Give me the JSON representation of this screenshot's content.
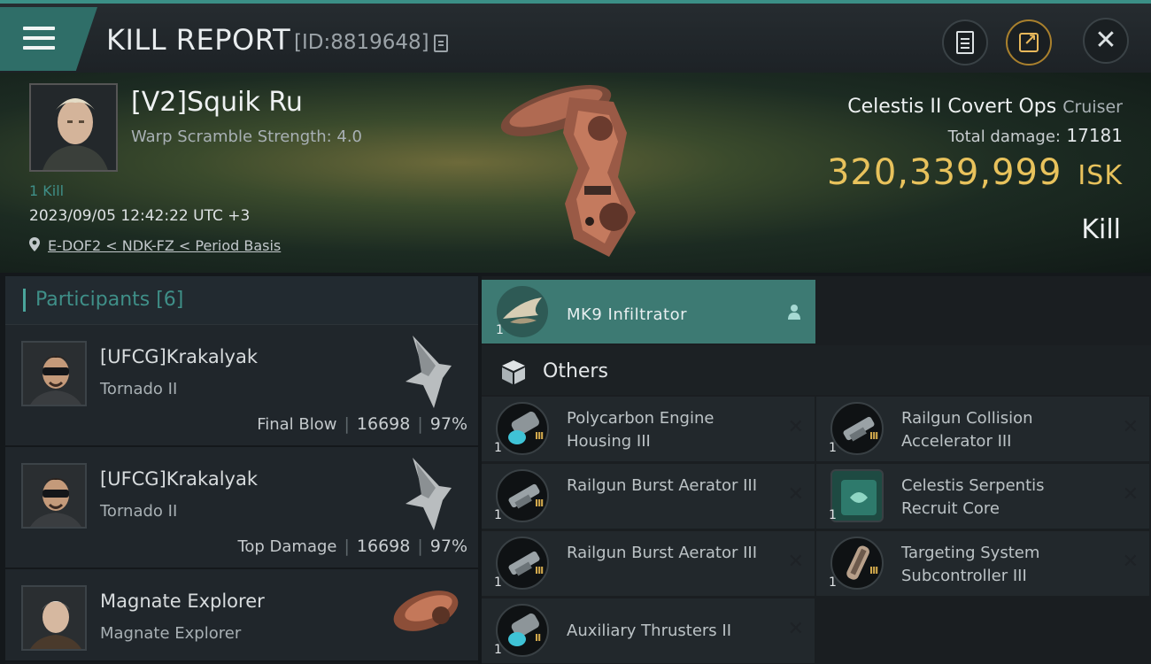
{
  "header": {
    "title": "KILL REPORT",
    "kill_id": "[ID:8819648]"
  },
  "victim": {
    "name": "[V2]Squik Ru",
    "warp_scramble": "Warp Scramble Strength: 4.0",
    "kills": "1 Kill",
    "datetime": "2023/09/05 12:42:22 UTC +3",
    "location": "E-DOF2 < NDK-FZ < Period Basis",
    "ship_name": "Celestis II Covert Ops",
    "ship_class": "Cruiser",
    "total_damage_label": "Total damage:",
    "total_damage": "17181",
    "isk_value": "320,339,999",
    "isk_unit": "ISK",
    "result": "Kill"
  },
  "participants": {
    "header": "Participants [6]",
    "rows": [
      {
        "name": "[UFCG]Krakalyak",
        "ship": "Tornado II",
        "label": "Final Blow",
        "damage": "16698",
        "percent": "97%"
      },
      {
        "name": "[UFCG]Krakalyak",
        "ship": "Tornado II",
        "label": "Top Damage",
        "damage": "16698",
        "percent": "97%"
      },
      {
        "name": "Magnate Explorer",
        "ship": "Magnate Explorer"
      }
    ]
  },
  "items": {
    "victim_item": {
      "name": "MK9 Infiltrator",
      "qty": "1"
    },
    "others_header": "Others",
    "list": [
      {
        "name": "Polycarbon Engine Housing III",
        "qty": "1",
        "tier": "III",
        "icon": "engine-icon"
      },
      {
        "name": "Railgun Collision Accelerator III",
        "qty": "1",
        "tier": "III",
        "icon": "railgun-rig-icon"
      },
      {
        "name": "Railgun Burst Aerator III",
        "qty": "1",
        "tier": "III",
        "icon": "railgun-rig-icon"
      },
      {
        "name": "Celestis Serpentis Recruit Core",
        "qty": "1",
        "tier": "",
        "icon": "core-icon"
      },
      {
        "name": "Railgun Burst Aerator III",
        "qty": "1",
        "tier": "III",
        "icon": "railgun-rig-icon"
      },
      {
        "name": "Targeting System Subcontroller III",
        "qty": "1",
        "tier": "III",
        "icon": "targeting-icon"
      },
      {
        "name": "Auxiliary Thrusters II",
        "qty": "1",
        "tier": "II",
        "icon": "thruster-icon"
      }
    ]
  },
  "colors": {
    "accent": "#3d7a73",
    "isk": "#e8c25c",
    "kills": "#3f8f88"
  }
}
